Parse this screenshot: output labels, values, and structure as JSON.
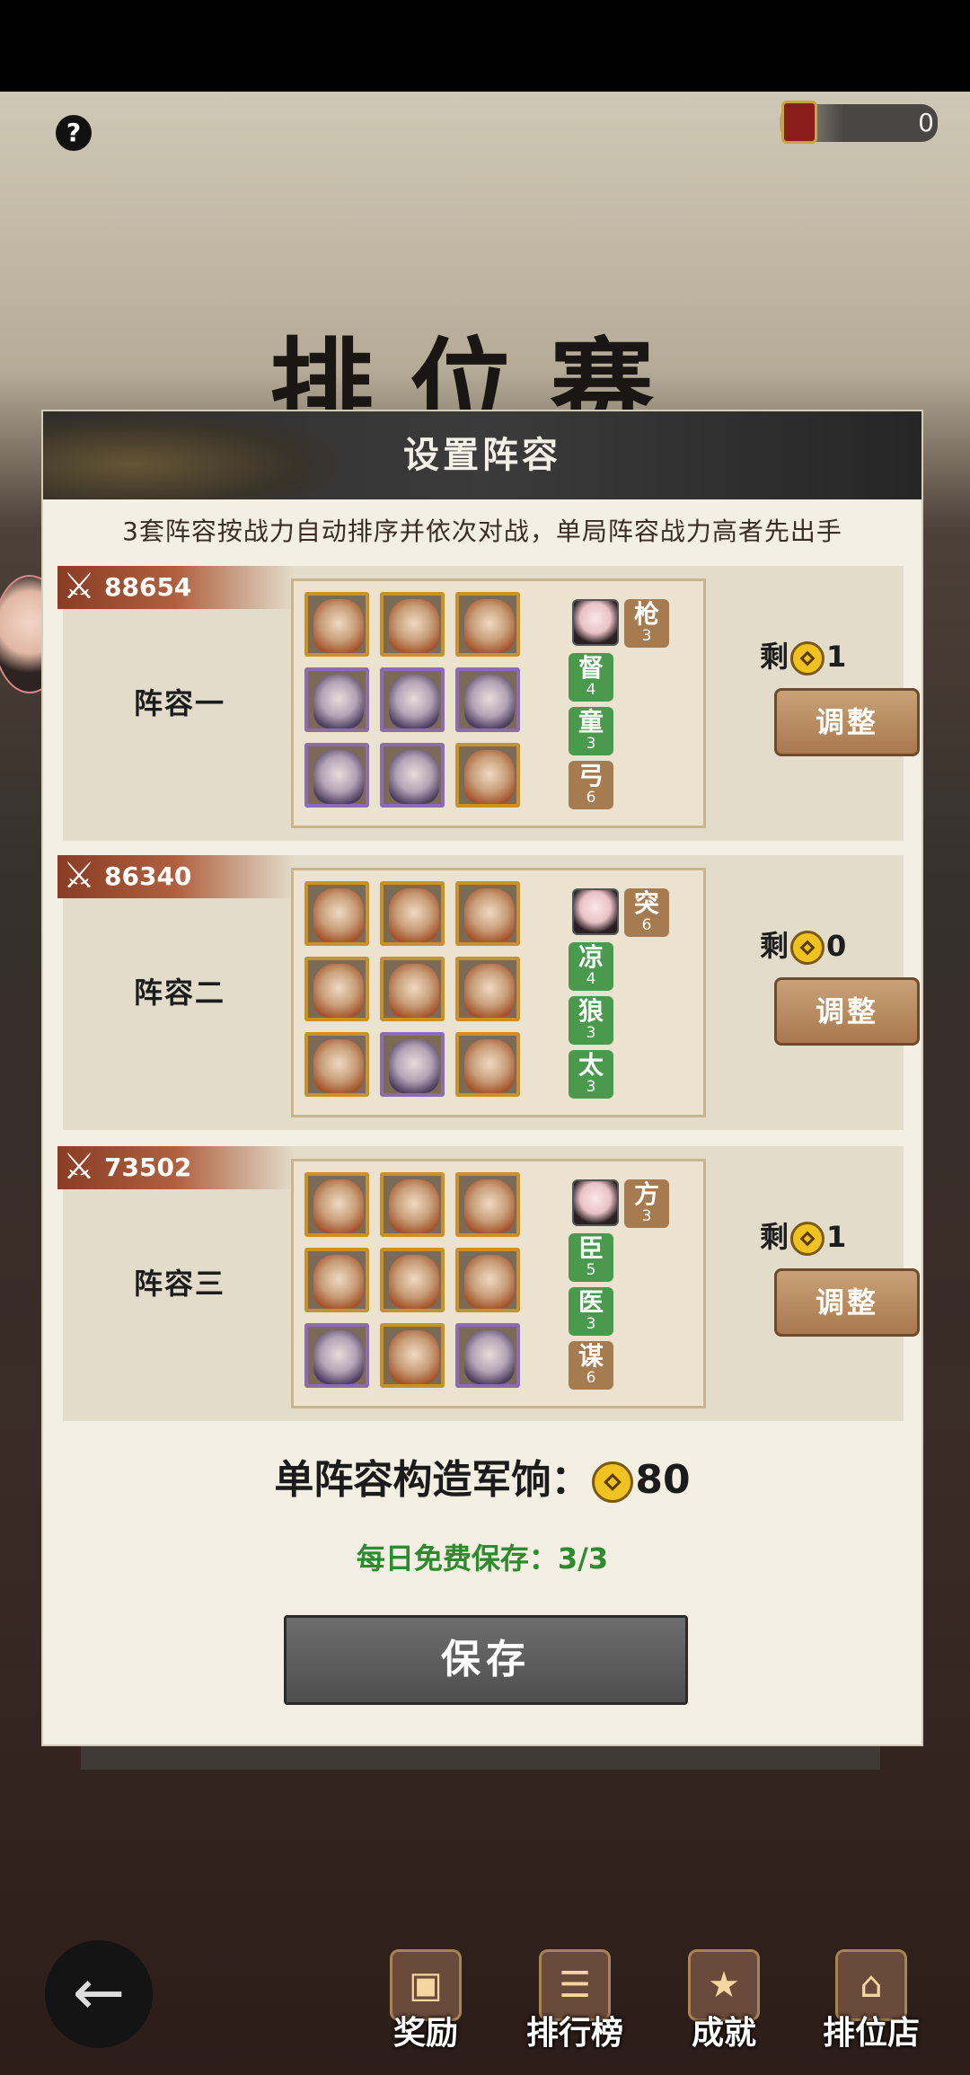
{
  "top": {
    "currency_value": "0"
  },
  "background_title": "排位赛",
  "modal": {
    "title": "设置阵容",
    "subtitle": "3套阵容按战力自动排序并依次对战，单局阵容战力高者先出手",
    "lineups": [
      {
        "name": "阵容一",
        "power": "88654",
        "remain_label": "剩",
        "remain_count": "1",
        "adjust_label": "调整",
        "heroes": [
          "orange",
          "orange",
          "orange",
          "purple",
          "purple",
          "purple",
          "purple",
          "purple",
          "orange"
        ],
        "bonds": [
          {
            "char": "枪",
            "level": "3",
            "color": "brown"
          },
          {
            "char": "督",
            "level": "4",
            "color": "green"
          },
          {
            "char": "童",
            "level": "3",
            "color": "green"
          },
          {
            "char": "弓",
            "level": "6",
            "color": "brown"
          }
        ]
      },
      {
        "name": "阵容二",
        "power": "86340",
        "remain_label": "剩",
        "remain_count": "0",
        "adjust_label": "调整",
        "heroes": [
          "orange",
          "orange",
          "orange",
          "orange",
          "orange",
          "orange",
          "orange",
          "purple",
          "orange"
        ],
        "bonds": [
          {
            "char": "突",
            "level": "6",
            "color": "brown"
          },
          {
            "char": "凉",
            "level": "4",
            "color": "green"
          },
          {
            "char": "狼",
            "level": "3",
            "color": "green"
          },
          {
            "char": "太",
            "level": "3",
            "color": "green"
          }
        ]
      },
      {
        "name": "阵容三",
        "power": "73502",
        "remain_label": "剩",
        "remain_count": "1",
        "adjust_label": "调整",
        "heroes": [
          "orange",
          "orange",
          "orange",
          "orange",
          "orange",
          "orange",
          "purple",
          "orange",
          "purple"
        ],
        "bonds": [
          {
            "char": "方",
            "level": "3",
            "color": "brown"
          },
          {
            "char": "臣",
            "level": "5",
            "color": "green"
          },
          {
            "char": "医",
            "level": "3",
            "color": "green"
          },
          {
            "char": "谋",
            "level": "6",
            "color": "brown"
          }
        ]
      }
    ],
    "cost_label": "单阵容构造军饷：",
    "cost_value": "80",
    "free_save_label": "每日免费保存：",
    "free_save_value": "3/3",
    "save_label": "保存"
  },
  "bottom_nav": [
    {
      "label": "奖励",
      "icon": "reward-chest-icon"
    },
    {
      "label": "排行榜",
      "icon": "ranking-board-icon"
    },
    {
      "label": "成就",
      "icon": "achievement-icon"
    },
    {
      "label": "排位店",
      "icon": "ranked-shop-icon"
    }
  ]
}
